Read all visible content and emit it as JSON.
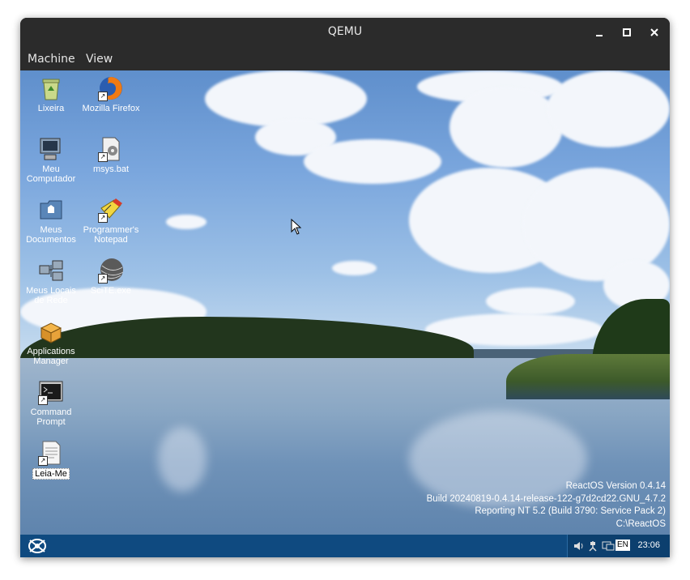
{
  "window": {
    "title": "QEMU",
    "controls": [
      "minimize",
      "maximize",
      "close"
    ]
  },
  "menubar": {
    "items": [
      "Machine",
      "View"
    ]
  },
  "desktop": {
    "icons": [
      {
        "label": "Lixeira",
        "icon": "recycle-bin-icon"
      },
      {
        "label": "Mozilla Firefox",
        "icon": "firefox-icon"
      },
      {
        "label": "Meu Computador",
        "icon": "computer-icon"
      },
      {
        "label": "msys.bat",
        "icon": "batch-file-icon"
      },
      {
        "label": "Meus Documentos",
        "icon": "documents-folder-icon"
      },
      {
        "label": "Programmer's Notepad",
        "icon": "notepad-icon"
      },
      {
        "label": "Meus Locais de Rede",
        "icon": "network-places-icon"
      },
      {
        "label": "SciTE.exe",
        "icon": "scite-icon"
      },
      {
        "label": "Applications Manager",
        "icon": "applications-manager-icon"
      },
      {
        "label": "Command Prompt",
        "icon": "command-prompt-icon"
      },
      {
        "label": "Leia-Me",
        "icon": "text-document-icon"
      }
    ],
    "version_info": [
      "ReactOS Version 0.4.14",
      "Build 20240819-0.4.14-release-122-g7d2cd22.GNU_4.7.2",
      "Reporting NT 5.2 (Build 3790: Service Pack 2)",
      "C:\\ReactOS"
    ]
  },
  "taskbar": {
    "tray": {
      "language": "EN",
      "icons": [
        "volume-icon",
        "network-icon",
        "display-icon"
      ]
    },
    "clock": "23:06"
  },
  "colors": {
    "titlebar": "#2b2b2b",
    "taskbar": "#0f4a80",
    "tray": "#0c3f6e"
  }
}
